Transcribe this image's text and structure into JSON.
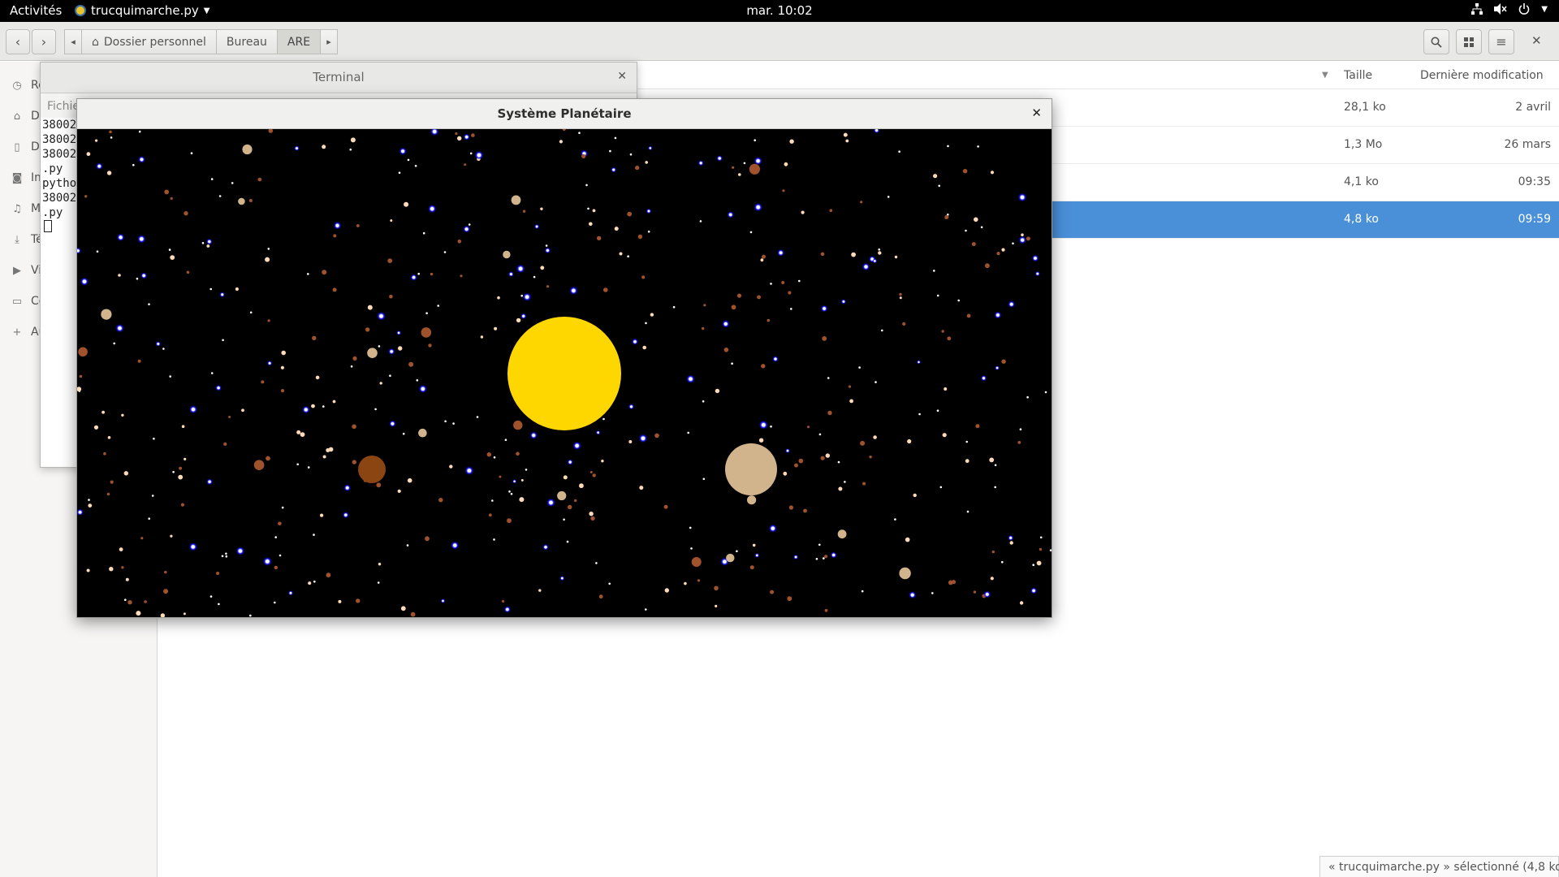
{
  "topbar": {
    "activities": "Activités",
    "app_name": "trucquimarche.py",
    "clock": "mar. 10:02"
  },
  "nautilus": {
    "path": [
      "Dossier personnel",
      "Bureau",
      "ARE"
    ],
    "sidebar_items": [
      {
        "label": "Ré",
        "icon": "recent-icon"
      },
      {
        "label": "Do",
        "icon": "home-icon"
      },
      {
        "label": "Do",
        "icon": "document-icon"
      },
      {
        "label": "Im",
        "icon": "camera-icon"
      },
      {
        "label": "Mu",
        "icon": "music-icon"
      },
      {
        "label": "Té",
        "icon": "download-icon"
      },
      {
        "label": "Vi",
        "icon": "video-icon"
      },
      {
        "label": "Co",
        "icon": "trash-icon"
      },
      {
        "label": "Au",
        "icon": "plus-icon"
      }
    ],
    "columns": {
      "size": "Taille",
      "modified": "Dernière modification"
    },
    "rows": [
      {
        "size": "28,1 ko",
        "date": "2 avril",
        "selected": false
      },
      {
        "size": "1,3 Mo",
        "date": "26 mars",
        "selected": false
      },
      {
        "size": "4,1 ko",
        "date": "09:35",
        "selected": false
      },
      {
        "size": "4,8 ko",
        "date": "09:59",
        "selected": true
      }
    ],
    "status": "« trucquimarche.py » sélectionné  (4,8 ko)"
  },
  "terminal": {
    "title": "Terminal",
    "menu": "Fichie",
    "lines": [
      "38002",
      "38002",
      "38002",
      ".py",
      "pytho",
      "38002",
      ".py"
    ]
  },
  "planet_window": {
    "title": "Système Planétaire",
    "colors": {
      "sun": "#FFD700",
      "planet_tan": "#D2B48C",
      "planet_brown": "#8B4513",
      "star_blue": "#0000FF",
      "star_white": "#FFFFFF",
      "star_orange": "#A0522D",
      "star_peach": "#FFDAB9"
    }
  }
}
